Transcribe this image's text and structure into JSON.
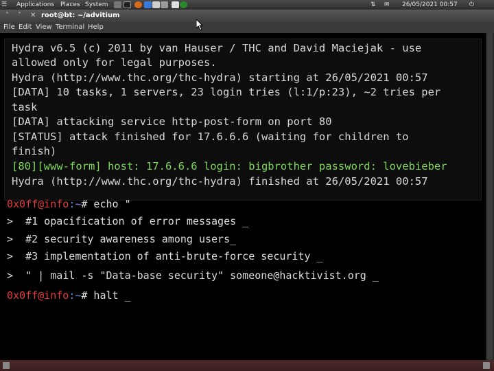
{
  "panel": {
    "applications": "Applications",
    "places": "Places",
    "system": "System",
    "clock": "26/05/2021 00:57"
  },
  "window": {
    "title": "root@bt: ~/advitium"
  },
  "menubar": {
    "file": "File",
    "edit": "Edit",
    "view": "View",
    "terminal": "Terminal",
    "help": "Help"
  },
  "output": {
    "l1": "Hydra v6.5 (c) 2011 by van Hauser / THC and David Maciejak - use",
    "l2": "allowed only for legal purposes.",
    "l3": "Hydra (http://www.thc.org/thc-hydra) starting at 26/05/2021 00:57",
    "l4": "[DATA] 10 tasks, 1 servers, 23 login tries (l:1/p:23), ~2 tries per",
    "l5": "task",
    "l6": "[DATA] attacking service http-post-form on port 80",
    "l7": "[STATUS] attack finished for 17.6.6.6 (waiting for children to",
    "l8": "finish)",
    "l9": "[80][www-form] host: 17.6.6.6 login: bigbrother password: lovebieber",
    "l10": "Hydra (http://www.thc.org/thc-hydra) finished at 26/05/2021 00:57"
  },
  "shell": {
    "prompt_user": "0x0ff@info",
    "prompt_path": ":~",
    "prompt_hash": "#",
    "cmd1": " echo \"",
    "c2": ">  #1 opacification of error messages _",
    "c3": ">  #2 security awareness among users_",
    "c4": ">  #3 implementation of anti-brute-force security _",
    "c5": ">  \" | mail -s \"Data-base security\" someone@hacktivist.org _",
    "cmd2": " halt _"
  }
}
